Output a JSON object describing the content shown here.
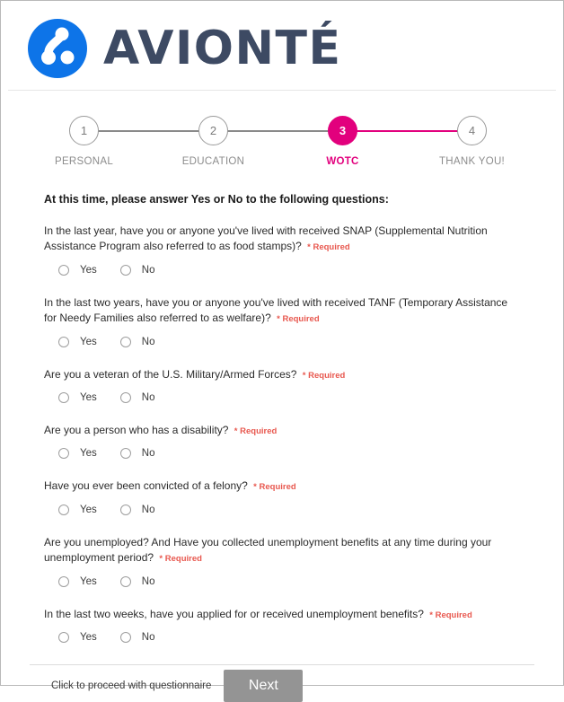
{
  "brand": {
    "wordmark": "AVIONTÉ",
    "logo_icon": "avionte-molecule-logo",
    "logo_color": "#0d74e8",
    "wordmark_color": "#3d4a63",
    "accent_color": "#e2007d",
    "required_color": "#e8584f"
  },
  "stepper": {
    "steps": [
      {
        "number": "1",
        "label": "PERSONAL",
        "state": "inactive"
      },
      {
        "number": "2",
        "label": "EDUCATION",
        "state": "inactive"
      },
      {
        "number": "3",
        "label": "WOTC",
        "state": "active"
      },
      {
        "number": "4",
        "label": "THANK YOU!",
        "state": "inactive"
      }
    ]
  },
  "form": {
    "intro": "At this time, please answer Yes or No to the following questions:",
    "required_marker": "* Required",
    "option_yes": "Yes",
    "option_no": "No",
    "questions": [
      {
        "text": "In the last year, have you or anyone you've lived with received SNAP (Supplemental Nutrition Assistance Program also referred to as food stamps)?"
      },
      {
        "text": "In the last two years, have you or anyone you've lived with received TANF (Temporary Assistance for Needy Families also referred to as welfare)?"
      },
      {
        "text": "Are you a veteran of the U.S. Military/Armed Forces?"
      },
      {
        "text": "Are you a person who has a disability?"
      },
      {
        "text": "Have you ever been convicted of a felony?"
      },
      {
        "text": "Are you unemployed? And Have you collected unemployment benefits at any time during your unemployment period?"
      },
      {
        "text": "In the last two weeks, have you applied for or received unemployment benefits?"
      }
    ]
  },
  "footer": {
    "proceed_text": "Click to proceed with questionnaire",
    "next_label": "Next"
  }
}
